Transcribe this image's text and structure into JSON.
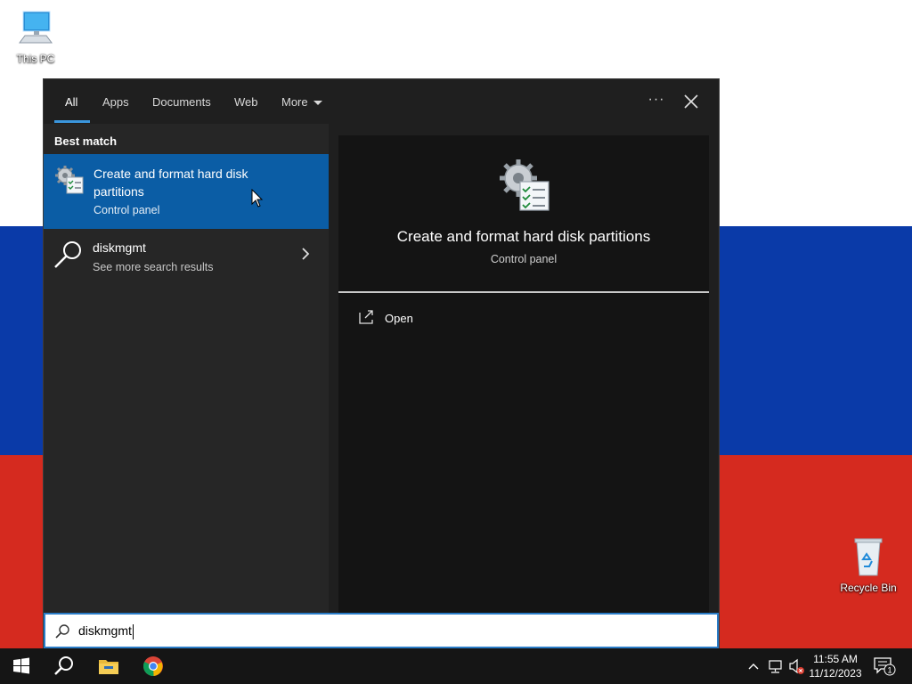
{
  "desktop": {
    "icons": [
      {
        "label": "This PC"
      },
      {
        "label": "Recycle Bin"
      }
    ]
  },
  "search_panel": {
    "tabs": [
      {
        "label": "All"
      },
      {
        "label": "Apps"
      },
      {
        "label": "Documents"
      },
      {
        "label": "Web"
      },
      {
        "label": "More"
      }
    ],
    "more_options_label": "···",
    "best_match_heading": "Best match",
    "best_match": {
      "title": "Create and format hard disk partitions",
      "subtitle": "Control panel"
    },
    "other_result": {
      "title": "diskmgmt",
      "subtitle": "See more search results"
    },
    "detail": {
      "title": "Create and format hard disk partitions",
      "subtitle": "Control panel",
      "actions": [
        {
          "label": "Open",
          "icon": "open-icon"
        }
      ]
    },
    "search": {
      "value": "diskmgmt"
    }
  },
  "taskbar": {
    "pinned": [
      "start-icon",
      "search-icon",
      "file-explorer-icon",
      "chrome-icon"
    ],
    "clock": {
      "time": "11:55 AM",
      "date": "11/12/2023"
    },
    "notification_count": "1"
  },
  "colors": {
    "accent": "#0b5da5",
    "tab_underline": "#3a96dd",
    "flag_blue": "#0a3aa8",
    "flag_red": "#d52a1f"
  }
}
